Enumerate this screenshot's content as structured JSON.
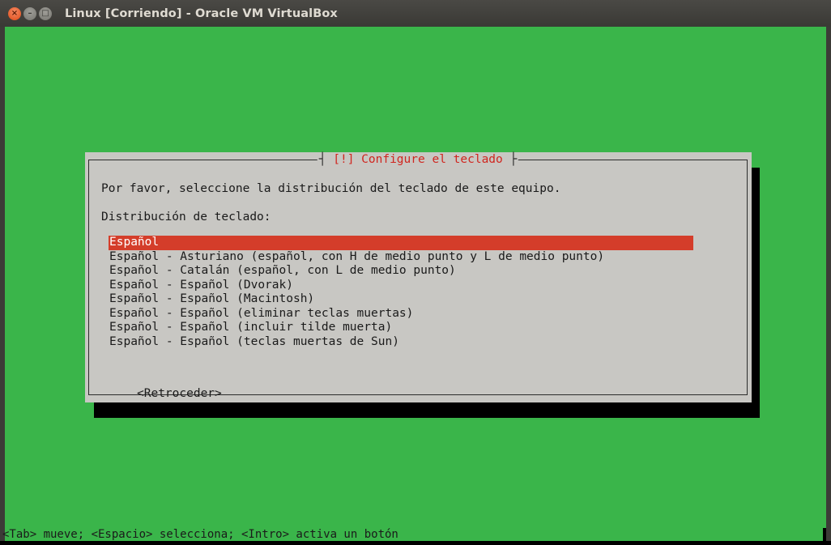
{
  "window": {
    "title": "Linux [Corriendo] - Oracle VM VirtualBox",
    "controls": {
      "close": "×",
      "minimize": "–",
      "maximize": "□"
    }
  },
  "dialog": {
    "title": "[!] Configure el teclado",
    "prompt": "Por favor, seleccione la distribución del teclado de este equipo.",
    "field_label": "Distribución de teclado:",
    "options": [
      "Español",
      "Español - Asturiano (español, con H de medio punto y L de medio punto)",
      "Español - Catalán (español, con L de medio punto)",
      "Español - Español (Dvorak)",
      "Español - Español (Macintosh)",
      "Español - Español (eliminar teclas muertas)",
      "Español - Español (incluir tilde muerta)",
      "Español - Español (teclas muertas de Sun)"
    ],
    "selected_index": 0,
    "back_button": "<Retroceder>"
  },
  "statusbar": {
    "help": "<Tab> mueve; <Espacio> selecciona; <Intro> activa un botón"
  },
  "colors": {
    "screen_bg": "#3ab54a",
    "dialog_bg": "#c8c7c3",
    "selection_bg": "#d43d2a",
    "title_text": "#d0261f"
  }
}
